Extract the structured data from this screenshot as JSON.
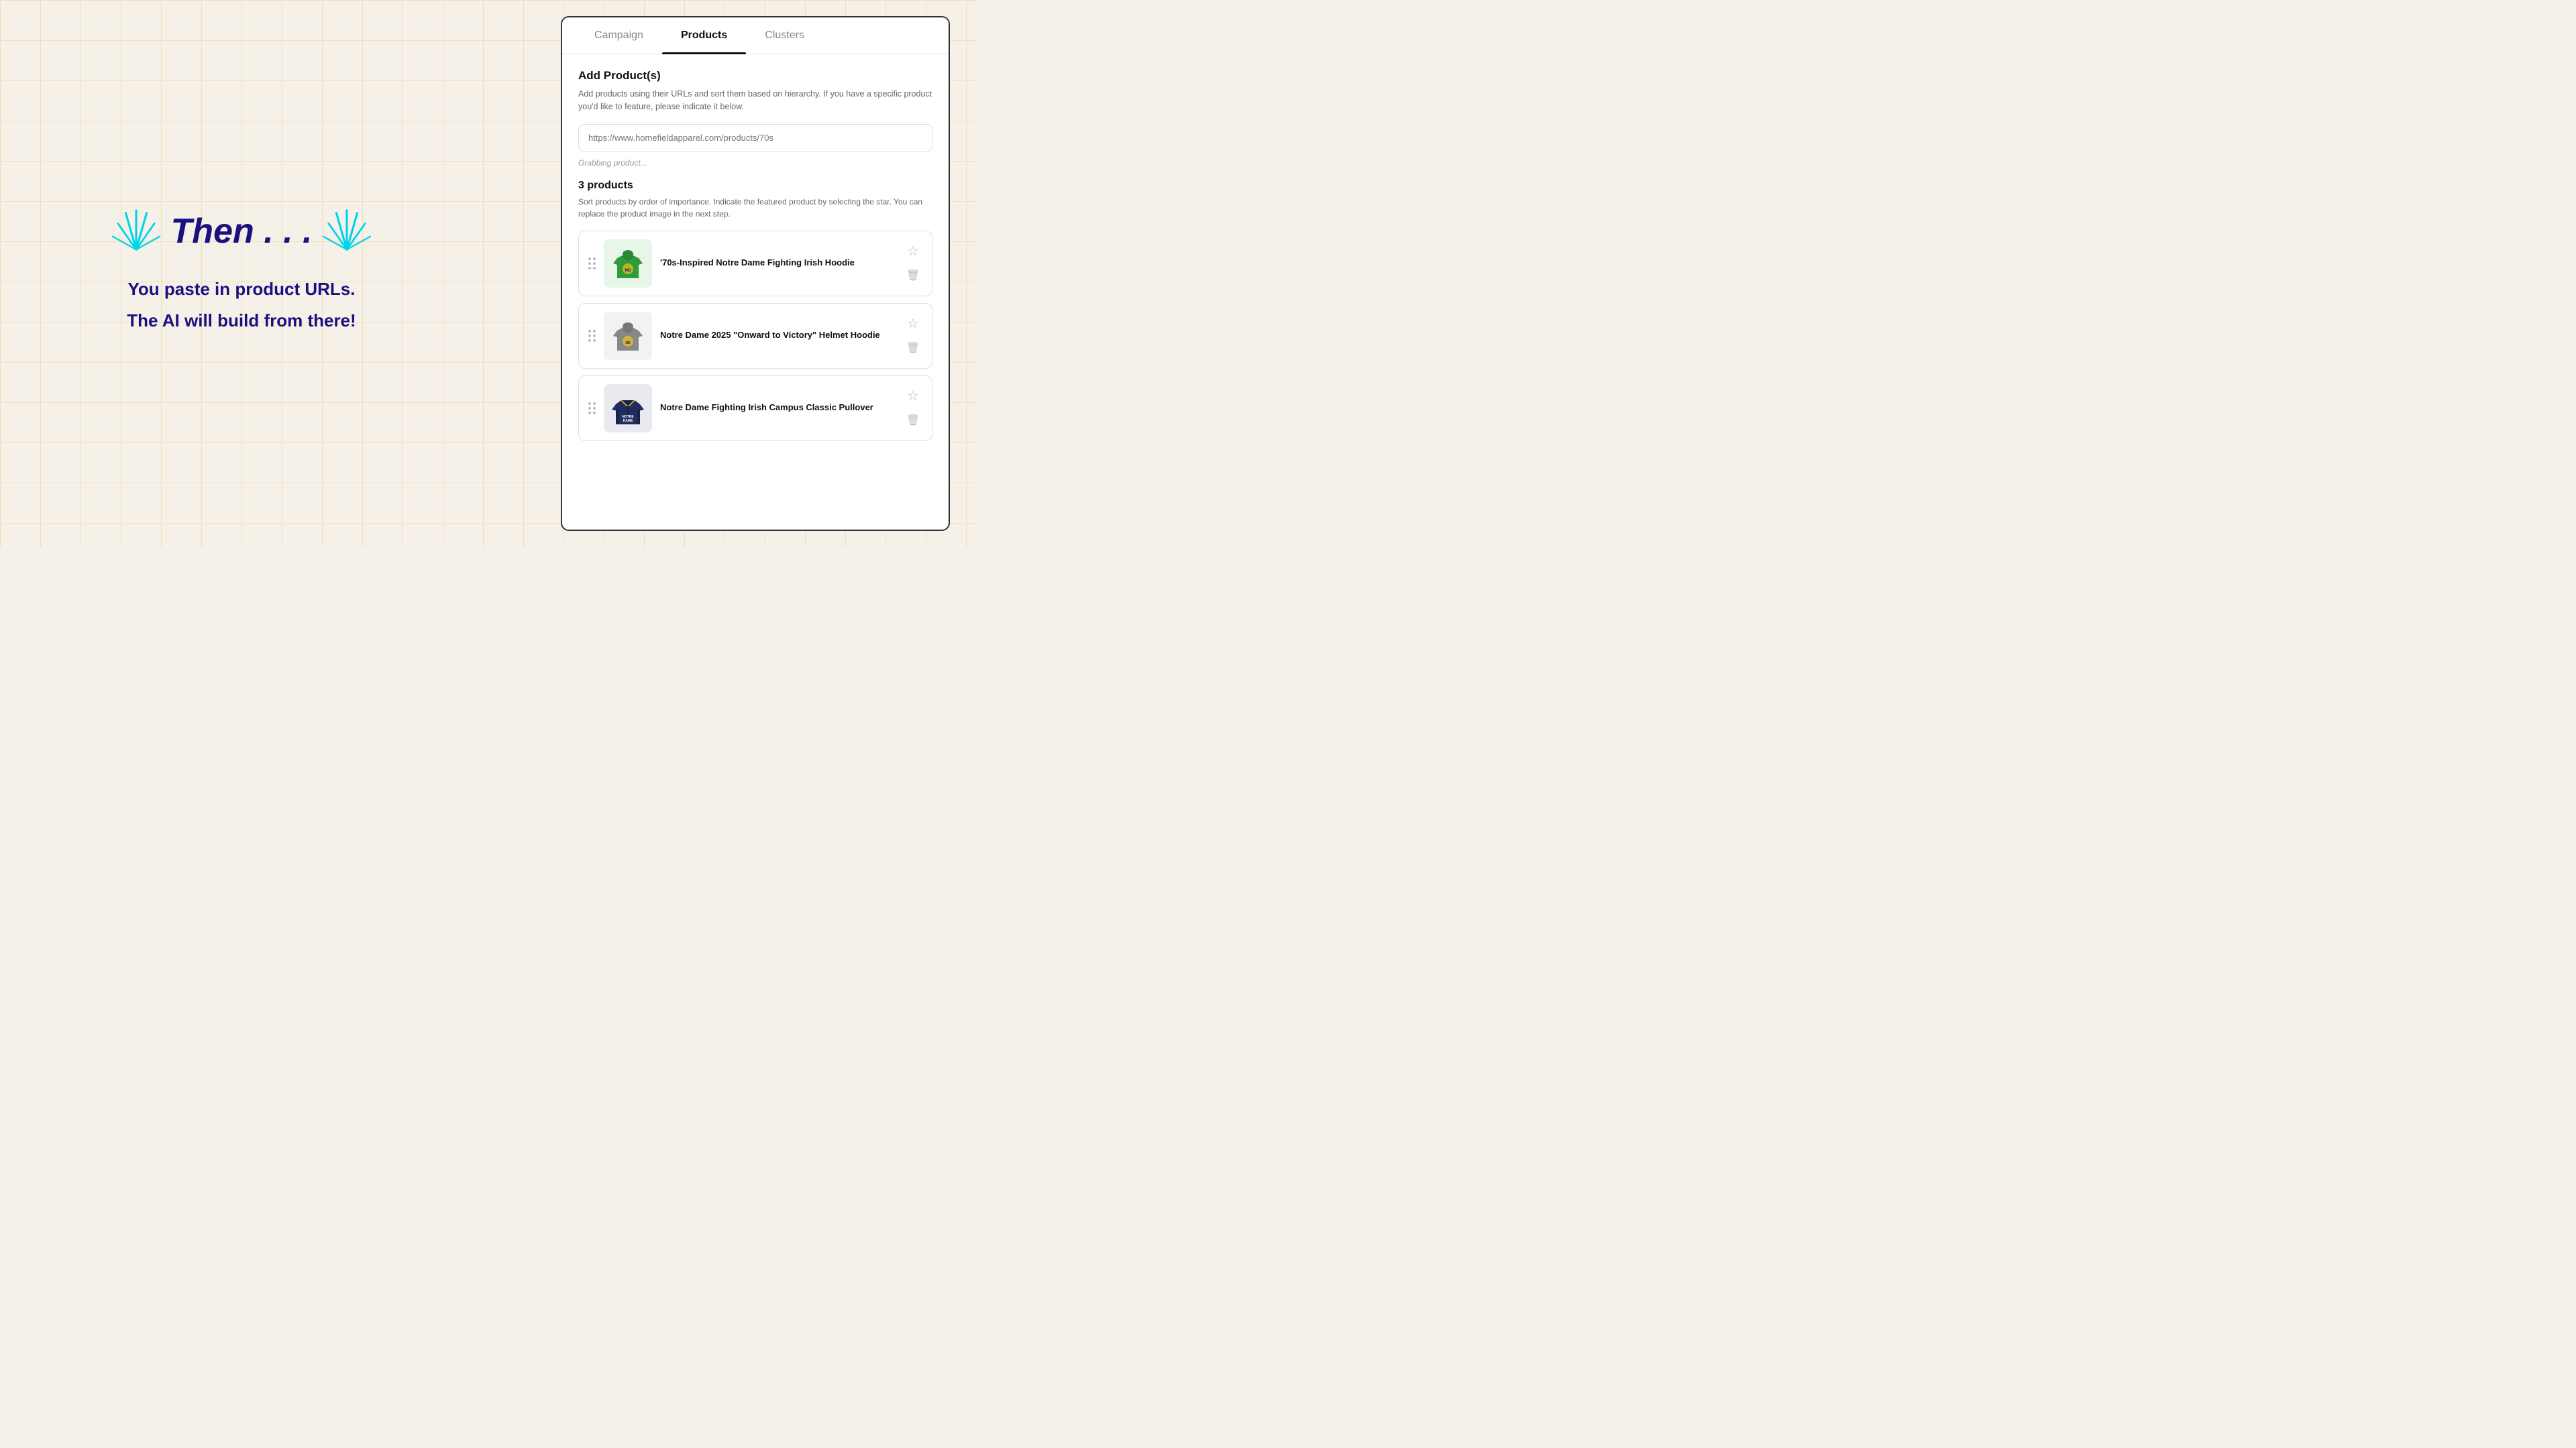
{
  "background": {
    "grid_color": "#f0c060"
  },
  "left_panel": {
    "then_label": "Then . . .",
    "body_lines": [
      "You paste in product URLs.",
      "The AI will build from there!"
    ]
  },
  "right_panel": {
    "tabs": [
      {
        "id": "campaign",
        "label": "Campaign",
        "active": false
      },
      {
        "id": "products",
        "label": "Products",
        "active": true
      },
      {
        "id": "clusters",
        "label": "Clusters",
        "active": false
      }
    ],
    "add_products": {
      "title": "Add Product(s)",
      "description": "Add products using their URLs and sort them based on hierarchy. If you have a specific product you'd like to feature, please indicate it below.",
      "url_placeholder": "https://www.homefieldapparel.com/products/70s",
      "grabbing_status": "Grabbing product...",
      "products_count_label": "3 products",
      "products_description": "Sort products by order of importance. Indicate the featured product by selecting the star. You can replace the product image in the next step.",
      "products": [
        {
          "id": 1,
          "name": "'70s-Inspired Notre Dame Fighting Irish Hoodie",
          "color": "#3a9e4a",
          "img_type": "green_hoodie"
        },
        {
          "id": 2,
          "name": "Notre Dame 2025 \"Onward to Victory\" Helmet Hoodie",
          "color": "#888",
          "img_type": "gray_hoodie"
        },
        {
          "id": 3,
          "name": "Notre Dame Fighting Irish Campus Classic Pullover",
          "color": "#2a3a6a",
          "img_type": "navy_jacket"
        }
      ]
    }
  }
}
